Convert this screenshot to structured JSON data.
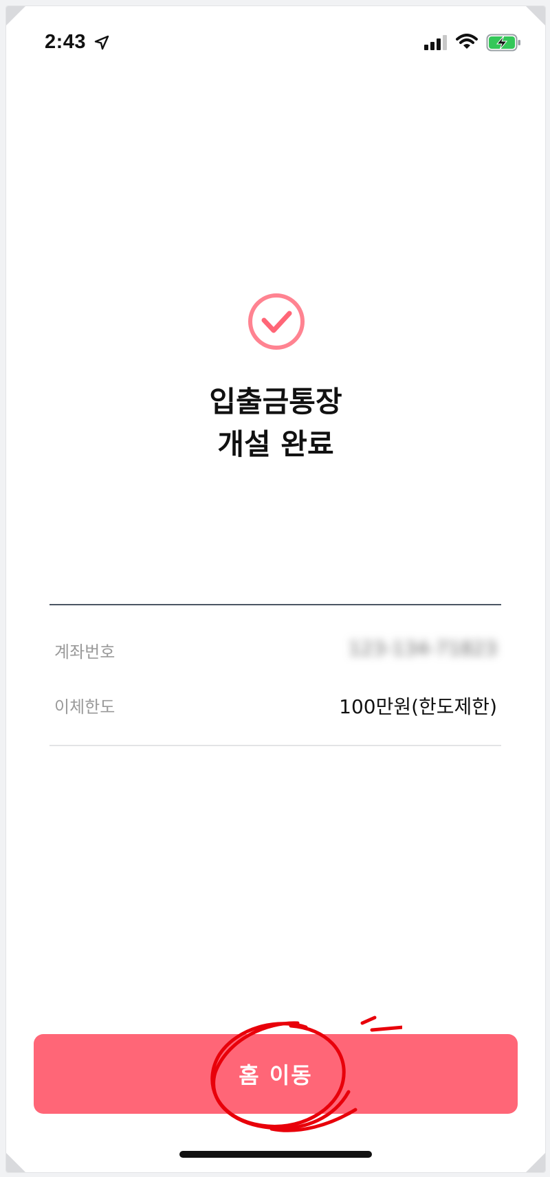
{
  "status_bar": {
    "time": "2:43",
    "location_icon": "location-arrow-icon",
    "signal_icon": "cellular-signal-icon",
    "wifi_icon": "wifi-icon",
    "battery_icon": "battery-charging-icon"
  },
  "result": {
    "icon": "check-circle-icon",
    "title_line1": "입출금통장",
    "title_line2": "개설 완료"
  },
  "details": {
    "rows": [
      {
        "label": "계좌번호",
        "value": "123-134-71823",
        "obscured": true
      },
      {
        "label": "이체한도",
        "value": "100만원(한도제한)"
      }
    ]
  },
  "home_button": {
    "label": "홈 이동"
  },
  "colors": {
    "accent": "#ff6677",
    "check_ring": "#ff8391",
    "annotation": "#e8000a"
  }
}
